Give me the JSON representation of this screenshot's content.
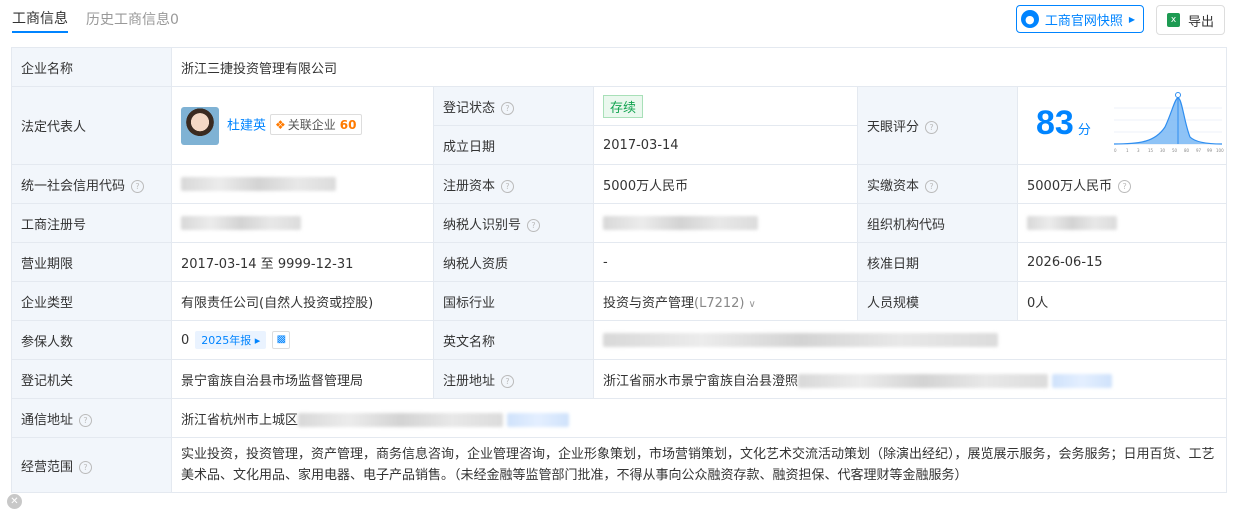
{
  "tabs": [
    {
      "label": "工商信息"
    },
    {
      "label": "历史工商信息0"
    }
  ],
  "buttons": {
    "snapshot": "工商官网快照",
    "export": "导出"
  },
  "fields": {
    "company_name_label": "企业名称",
    "company_name": "浙江三捷投资管理有限公司",
    "legal_rep_label": "法定代表人",
    "legal_rep_name": "杜建英",
    "related_label": "关联企业",
    "related_count": "60",
    "reg_status_label": "登记状态",
    "reg_status": "存续",
    "found_date_label": "成立日期",
    "found_date": "2017-03-14",
    "score_label": "天眼评分",
    "score": "83",
    "score_unit": "分",
    "score_axis": [
      "0",
      "1",
      "3",
      "15",
      "30",
      "50",
      "80",
      "97",
      "99",
      "100"
    ],
    "credit_code_label": "统一社会信用代码",
    "reg_capital_label": "注册资本",
    "reg_capital": "5000万人民币",
    "paid_capital_label": "实缴资本",
    "paid_capital": "5000万人民币",
    "biz_reg_no_label": "工商注册号",
    "taxpayer_id_label": "纳税人识别号",
    "org_code_label": "组织机构代码",
    "term_label": "营业期限",
    "term": "2017-03-14 至 9999-12-31",
    "taxpayer_qual_label": "纳税人资质",
    "taxpayer_qual": "-",
    "approve_date_label": "核准日期",
    "approve_date": "2026-06-15",
    "type_label": "企业类型",
    "type": "有限责任公司(自然人投资或控股)",
    "industry_label": "国标行业",
    "industry": "投资与资产管理",
    "industry_code": "(L7212)",
    "staff_label": "人员规模",
    "staff": "0人",
    "insured_label": "参保人数",
    "insured": "0",
    "insured_report": "2025年报",
    "english_name_label": "英文名称",
    "authority_label": "登记机关",
    "authority": "景宁畲族自治县市场监督管理局",
    "reg_address_label": "注册地址",
    "reg_address": "浙江省丽水市景宁畲族自治县澄照",
    "mail_address_label": "通信地址",
    "mail_address": "浙江省杭州市上城区",
    "scope_label": "经营范围",
    "scope": "实业投资，投资管理，资产管理，商务信息咨询，企业管理咨询，企业形象策划，市场营销策划，文化艺术交流活动策划（除演出经纪），展览展示服务，会务服务；日用百货、工艺美术品、文化用品、家用电器、电子产品销售。（未经金融等监管部门批准，不得从事向公众融资存款、融资担保、代客理财等金融服务）"
  }
}
